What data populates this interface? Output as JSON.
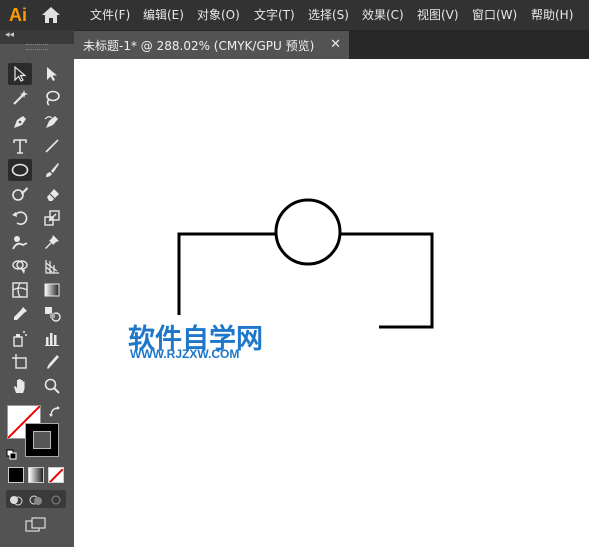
{
  "app": {
    "logo": "Ai"
  },
  "menu": [
    {
      "label": "文件(F)"
    },
    {
      "label": "编辑(E)"
    },
    {
      "label": "对象(O)"
    },
    {
      "label": "文字(T)"
    },
    {
      "label": "选择(S)"
    },
    {
      "label": "效果(C)"
    },
    {
      "label": "视图(V)"
    },
    {
      "label": "窗口(W)"
    },
    {
      "label": "帮助(H)"
    }
  ],
  "tab": {
    "label": "未标题-1* @ 288.02% (CMYK/GPU 预览)",
    "close": "✕"
  },
  "toolbar": {
    "collapse": "◂◂"
  },
  "watermark": {
    "title": "软件自学网",
    "url": "WWW.RJZXW.COM"
  },
  "colors": {
    "accent": "#ff9a00",
    "watermark": "#1e77c9",
    "canvas": "#ffffff",
    "panel": "#535353"
  }
}
